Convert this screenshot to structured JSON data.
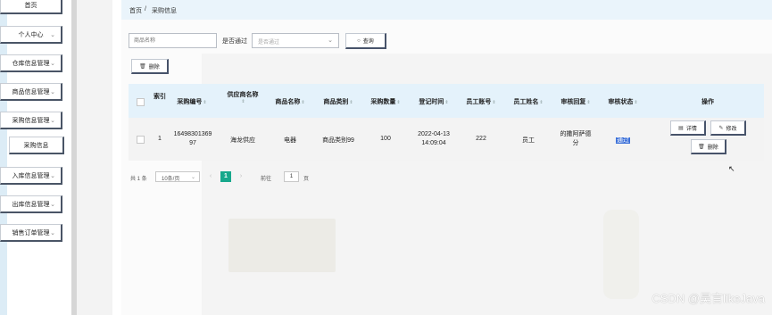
{
  "sidebar": {
    "items": [
      {
        "label": "首页",
        "chevron": false
      },
      {
        "label": "个人中心",
        "chevron": true
      },
      {
        "label": "仓库信息管理",
        "chevron": true
      },
      {
        "label": "商品信息管理",
        "chevron": true
      },
      {
        "label": "采购信息管理",
        "chevron": true
      },
      {
        "label": "采购信息",
        "chevron": false,
        "sub": true
      },
      {
        "label": "入库信息管理",
        "chevron": true
      },
      {
        "label": "出库信息管理",
        "chevron": true
      },
      {
        "label": "销售订单管理",
        "chevron": true
      }
    ]
  },
  "breadcrumb": {
    "home": "首页",
    "separator": "/",
    "current": "采购信息"
  },
  "search": {
    "name_placeholder": "商品名称",
    "pass_label": "是否通过",
    "pass_placeholder": "是否通过",
    "query_label": "查询",
    "delete_label": "删除"
  },
  "table": {
    "headers": {
      "index": "索引",
      "purchase_no": "采购编号",
      "supplier": "供应商名称",
      "goods_name": "商品名称",
      "goods_type": "商品类别",
      "quantity": "采购数量",
      "reg_time": "登记时间",
      "emp_no": "员工账号",
      "emp_name": "员工姓名",
      "reply": "审核回复",
      "status": "审核状态",
      "ops": "操作"
    },
    "row": {
      "index": "1",
      "purchase_no": "1649830136997",
      "supplier": "海龙供应",
      "goods_name": "电器",
      "goods_type": "商品类别99",
      "quantity": "100",
      "reg_time": "2022-04-13 14:09:04",
      "emp_no": "222",
      "emp_name": "员工",
      "reply": "的撒阿萨德分",
      "status": "通过"
    },
    "actions": {
      "detail": "详情",
      "edit": "修改",
      "delete": "删除"
    }
  },
  "pager": {
    "total": "共 1 条",
    "page_size": "10条/页",
    "current_page": "1",
    "goto_label": "前往",
    "goto_value": "1",
    "page_unit": "页"
  },
  "watermark": "CSDN @昊言likeJava",
  "colors": {
    "accent": "#17a88c",
    "header_bg": "#e4f2fb",
    "selection": "#3a6fd8"
  }
}
